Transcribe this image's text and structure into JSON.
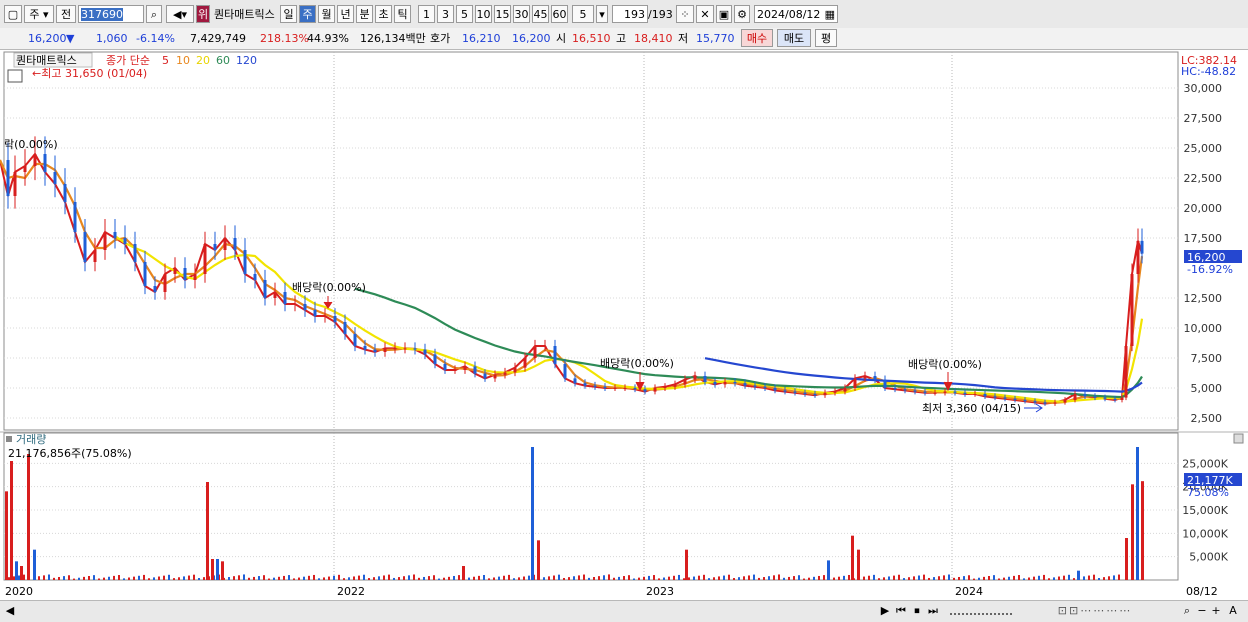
{
  "toolbar": {
    "period_label": "주",
    "prev_label": "전",
    "code": "317690",
    "badge": "위",
    "stock_name": "퀀타매트릭스",
    "tabs": [
      "일",
      "주",
      "월",
      "년",
      "분",
      "초",
      "틱"
    ],
    "selected_tab": "주",
    "intervals": [
      "1",
      "3",
      "5",
      "10",
      "15",
      "30",
      "45",
      "60"
    ],
    "interval_value": "5",
    "page_count": "193",
    "page_total": "/193",
    "date": "2024/08/12"
  },
  "quote": {
    "price": "16,200",
    "arrow": "▼",
    "change": "1,060",
    "change_pct": "-6.14%",
    "volume": "7,429,749",
    "volume_ratio": "218.13%",
    "turnover": "44.93%",
    "amount": "126,134백만",
    "ask_label": "호가",
    "ask": "16,210",
    "bid": "16,200",
    "open_label": "시",
    "open": "16,510",
    "high_label": "고",
    "high": "18,410",
    "low_label": "저",
    "low": "15,770",
    "buy_label": "매수",
    "sell_label": "매도",
    "eval_label": "평"
  },
  "price_panel": {
    "stock_label": "퀀타매트릭스",
    "legend_price": "종가 단순",
    "ma_labels": [
      "5",
      "10",
      "20",
      "60",
      "120"
    ],
    "ma_colors": [
      "#d81e1e",
      "#e8871e",
      "#f2e400",
      "#2e8b57",
      "#2547d0"
    ],
    "high_note": "←최고 31,650 (01/04)",
    "low_note": "최저 3,360 (04/15)",
    "dividend_notes": [
      "락(0.00%)",
      "배당락(0.00%)",
      "배당락(0.00%)",
      "배당락(0.00%)"
    ],
    "lc": "LC:382.14",
    "hc": "HC:-48.82",
    "current_price_tag": "16,200",
    "current_pct_tag": "-16.92%"
  },
  "volume_panel": {
    "title": "거래량",
    "info": "21,176,856주(75.08%)",
    "current_tag": "21,177K",
    "current_pct_tag": "75.08%"
  },
  "x_axis": {
    "labels": [
      "2020",
      "2022",
      "2023",
      "2024"
    ],
    "end_label": "08/12"
  },
  "chart_data": [
    {
      "type": "candlestick",
      "title": "퀀타매트릭스",
      "ylim": [
        1500,
        33000
      ],
      "yticks": [
        "30,000",
        "27,500",
        "25,000",
        "22,500",
        "20,000",
        "17,500",
        "12,500",
        "10,000",
        "7,500",
        "5,000",
        "2,500"
      ],
      "x_labels": [
        "2020",
        "2022",
        "2023",
        "2024"
      ],
      "annotations": {
        "high": {
          "value": 31650,
          "date": "01/04"
        },
        "low": {
          "value": 3360,
          "date": "04/15"
        }
      },
      "series_close_approx": [
        [
          0,
          24000
        ],
        [
          8,
          21000
        ],
        [
          15,
          23000
        ],
        [
          25,
          23500
        ],
        [
          35,
          24500
        ],
        [
          45,
          23000
        ],
        [
          55,
          22000
        ],
        [
          65,
          20500
        ],
        [
          75,
          18000
        ],
        [
          85,
          15500
        ],
        [
          95,
          16500
        ],
        [
          105,
          18000
        ],
        [
          115,
          17500
        ],
        [
          125,
          17000
        ],
        [
          135,
          15500
        ],
        [
          145,
          13500
        ],
        [
          155,
          13000
        ],
        [
          165,
          14500
        ],
        [
          175,
          15000
        ],
        [
          185,
          14000
        ],
        [
          195,
          14500
        ],
        [
          205,
          17000
        ],
        [
          215,
          16500
        ],
        [
          225,
          17500
        ],
        [
          235,
          16500
        ],
        [
          245,
          14500
        ],
        [
          255,
          14000
        ],
        [
          265,
          12500
        ],
        [
          275,
          13000
        ],
        [
          285,
          12000
        ],
        [
          295,
          12000
        ],
        [
          305,
          11500
        ],
        [
          315,
          11000
        ],
        [
          325,
          11000
        ],
        [
          335,
          10500
        ],
        [
          345,
          9500
        ],
        [
          355,
          8500
        ],
        [
          365,
          8200
        ],
        [
          375,
          8000
        ],
        [
          385,
          8300
        ],
        [
          395,
          8300
        ],
        [
          405,
          8300
        ],
        [
          415,
          8200
        ],
        [
          425,
          7800
        ],
        [
          435,
          7000
        ],
        [
          445,
          6500
        ],
        [
          455,
          6500
        ],
        [
          465,
          6800
        ],
        [
          475,
          6200
        ],
        [
          485,
          5800
        ],
        [
          495,
          6100
        ],
        [
          505,
          6300
        ],
        [
          515,
          6700
        ],
        [
          525,
          7500
        ],
        [
          535,
          8500
        ],
        [
          545,
          8500
        ],
        [
          555,
          7000
        ],
        [
          565,
          5800
        ],
        [
          575,
          5400
        ],
        [
          585,
          5200
        ],
        [
          595,
          5100
        ],
        [
          605,
          5000
        ],
        [
          615,
          5000
        ],
        [
          625,
          5000
        ],
        [
          635,
          4900
        ],
        [
          645,
          4700
        ],
        [
          655,
          5000
        ],
        [
          665,
          5100
        ],
        [
          675,
          5300
        ],
        [
          685,
          5700
        ],
        [
          695,
          6000
        ],
        [
          705,
          5500
        ],
        [
          715,
          5300
        ],
        [
          725,
          5500
        ],
        [
          735,
          5400
        ],
        [
          745,
          5200
        ],
        [
          755,
          5100
        ],
        [
          765,
          5000
        ],
        [
          775,
          4800
        ],
        [
          785,
          4700
        ],
        [
          795,
          4600
        ],
        [
          805,
          4500
        ],
        [
          815,
          4400
        ],
        [
          825,
          4600
        ],
        [
          835,
          4700
        ],
        [
          845,
          5000
        ],
        [
          855,
          5800
        ],
        [
          865,
          6000
        ],
        [
          875,
          5700
        ],
        [
          885,
          5000
        ],
        [
          895,
          4900
        ],
        [
          905,
          4800
        ],
        [
          915,
          4700
        ],
        [
          925,
          4600
        ],
        [
          935,
          4600
        ],
        [
          945,
          4700
        ],
        [
          955,
          4600
        ],
        [
          965,
          4500
        ],
        [
          975,
          4500
        ],
        [
          985,
          4300
        ],
        [
          995,
          4200
        ],
        [
          1005,
          4100
        ],
        [
          1015,
          4000
        ],
        [
          1025,
          3900
        ],
        [
          1035,
          3800
        ],
        [
          1045,
          3700
        ],
        [
          1055,
          3800
        ],
        [
          1065,
          4000
        ],
        [
          1075,
          4500
        ],
        [
          1085,
          4300
        ],
        [
          1095,
          4200
        ],
        [
          1105,
          4100
        ],
        [
          1115,
          4000
        ],
        [
          1122,
          4200
        ],
        [
          1126,
          8500
        ],
        [
          1132,
          14500
        ],
        [
          1138,
          17260
        ],
        [
          1142,
          16200
        ]
      ]
    },
    {
      "type": "bar",
      "title": "거래량",
      "ylim": [
        0,
        30000
      ],
      "yticks": [
        "25,000K",
        "20,000K",
        "15,000K",
        "10,000K",
        "5,000K"
      ],
      "values_k": [
        [
          6,
          19000
        ],
        [
          11,
          25500
        ],
        [
          16,
          4000
        ],
        [
          21,
          3000
        ],
        [
          28,
          27000
        ],
        [
          34,
          6500
        ],
        [
          207,
          21000
        ],
        [
          212,
          4500
        ],
        [
          217,
          4500
        ],
        [
          222,
          4000
        ],
        [
          463,
          3000
        ],
        [
          532,
          28500
        ],
        [
          538,
          8500
        ],
        [
          686,
          6500
        ],
        [
          828,
          4200
        ],
        [
          852,
          9500
        ],
        [
          858,
          6500
        ],
        [
          1078,
          2000
        ],
        [
          1126,
          9000
        ],
        [
          1132,
          20500
        ],
        [
          1137,
          28500
        ],
        [
          1142,
          21177
        ]
      ]
    }
  ],
  "bottom": {
    "buttons": [
      "◀",
      "▶",
      "⏮",
      "⏹",
      "⏭",
      "−",
      "+",
      "A"
    ]
  }
}
